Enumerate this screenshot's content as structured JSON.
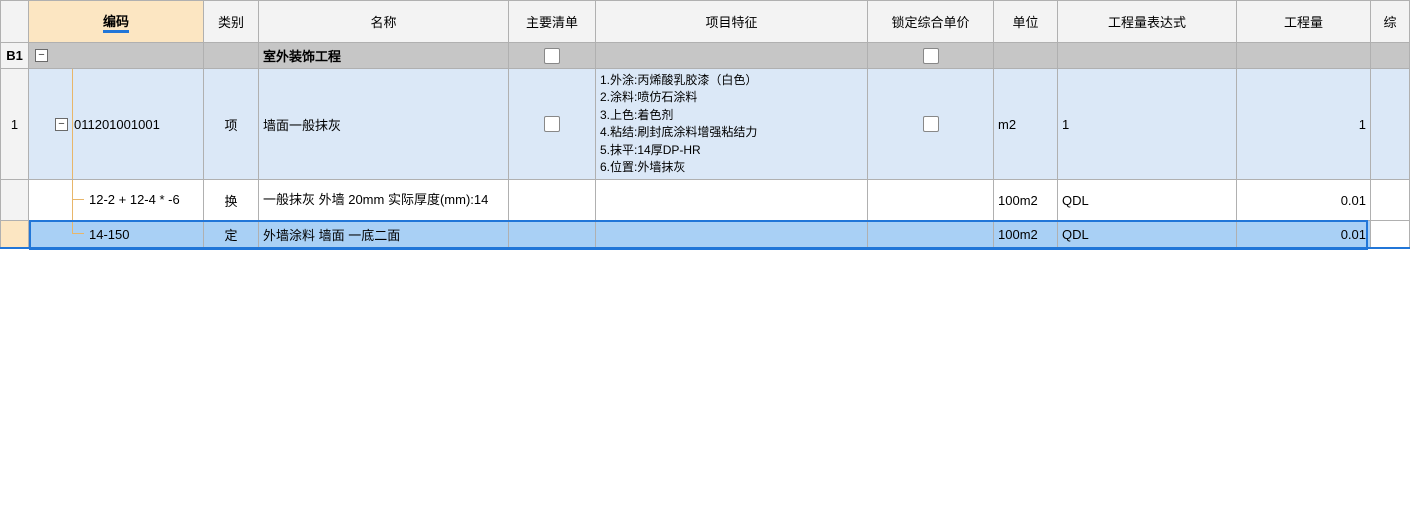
{
  "headers": {
    "code": "编码",
    "category": "类别",
    "name": "名称",
    "main_list": "主要清单",
    "features": "项目特征",
    "lock_price": "锁定综合单价",
    "unit": "单位",
    "qty_expr": "工程量表达式",
    "quantity": "工程量",
    "last": "综"
  },
  "rows": {
    "b1": {
      "num": "B1",
      "code": "",
      "category": "",
      "name": "室外装饰工程",
      "unit": "",
      "qty_expr": "",
      "quantity": ""
    },
    "r1": {
      "num": "1",
      "code": "011201001001",
      "category": "项",
      "name": "墙面一般抹灰",
      "features": "1.外涂:丙烯酸乳胶漆（白色）\n2.涂料:喷仿石涂料\n3.上色:着色剂\n4.粘结:刷封底涂料增强粘结力\n5.抹平:14厚DP-HR\n6.位置:外墙抹灰",
      "unit": "m2",
      "qty_expr": "1",
      "quantity": "1"
    },
    "r2": {
      "num": "",
      "code": "12-2 + 12-4 * -6",
      "category": "换",
      "name": "一般抹灰 外墙 20mm  实际厚度(mm):14",
      "unit": "100m2",
      "qty_expr": "QDL",
      "quantity": "0.01"
    },
    "r3": {
      "num": "",
      "code": "14-150",
      "category": "定",
      "name": "外墙涂料 墙面 一底二面",
      "unit": "100m2",
      "qty_expr": "QDL",
      "quantity": "0.01"
    }
  }
}
